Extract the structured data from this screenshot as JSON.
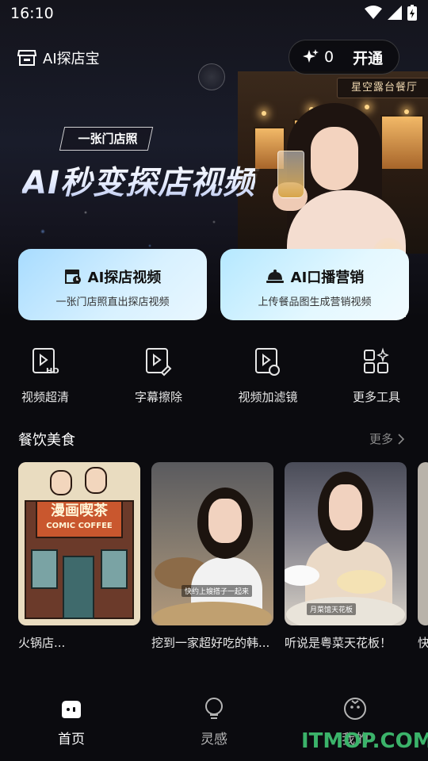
{
  "status_bar": {
    "time": "16:10"
  },
  "header": {
    "brand_name": "AI探店宝",
    "credits": "0",
    "open_label": "开通"
  },
  "hero": {
    "tag": "一张门店照",
    "headline": "AI秒变探店视频",
    "store_sign": "星空露台餐厅"
  },
  "feature_cards": [
    {
      "title": "AI探店视频",
      "subtitle": "一张门店照直出探店视频",
      "icon": "storefront-video-icon"
    },
    {
      "title": "AI口播营销",
      "subtitle": "上传餐品图生成营销视频",
      "icon": "cloche-icon"
    }
  ],
  "tools": [
    {
      "label": "视频超清",
      "icon": "video-hd-icon"
    },
    {
      "label": "字幕擦除",
      "icon": "subtitle-erase-icon"
    },
    {
      "label": "视频加滤镜",
      "icon": "video-filter-icon"
    },
    {
      "label": "更多工具",
      "icon": "grid-more-icon"
    }
  ],
  "section": {
    "title": "餐饮美食",
    "more_label": "更多"
  },
  "thumbnails": [
    {
      "caption": "火锅店...",
      "sign_cn": "漫画喫茶",
      "sign_en": "COMIC COFFEE"
    },
    {
      "caption": "挖到一家超好吃的韩...",
      "overlay": "快约上嫂搭子一起来"
    },
    {
      "caption": "听说是粤菜天花板！",
      "overlay": "月菜馆天花板"
    },
    {
      "caption": "快"
    }
  ],
  "bottom_nav": [
    {
      "label": "首页",
      "icon": "home-icon",
      "active": true
    },
    {
      "label": "灵感",
      "icon": "lightbulb-icon",
      "active": false
    },
    {
      "label": "我的",
      "icon": "profile-face-icon",
      "active": false
    }
  ],
  "watermark": "ITMOP.COM",
  "colors": {
    "background": "#0b0b0f",
    "card_blue": "#a8dcff",
    "watermark_green": "#3bb36a"
  }
}
